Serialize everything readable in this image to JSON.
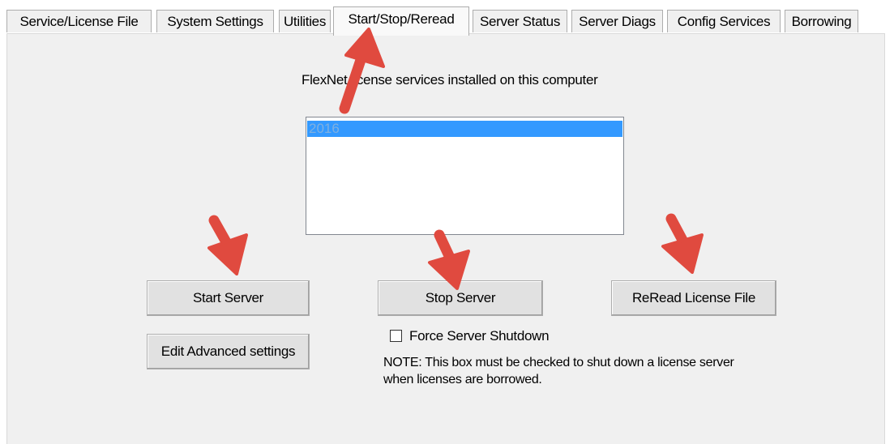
{
  "tabs": [
    {
      "label": "Service/License File"
    },
    {
      "label": "System Settings"
    },
    {
      "label": "Utilities"
    },
    {
      "label": "Start/Stop/Reread"
    },
    {
      "label": "Server Status"
    },
    {
      "label": "Server Diags"
    },
    {
      "label": "Config Services"
    },
    {
      "label": "Borrowing"
    }
  ],
  "active_tab": "Start/Stop/Reread",
  "services": {
    "heading": "FlexNet license services installed on this computer",
    "items": [
      "2016"
    ],
    "selected": "2016"
  },
  "buttons": {
    "start_server": "Start Server",
    "stop_server": "Stop Server",
    "reread_license": "ReRead License File",
    "edit_advanced": "Edit Advanced settings"
  },
  "force_shutdown": {
    "label": "Force Server Shutdown",
    "checked": false
  },
  "note": {
    "line1": "NOTE:  This box must be checked to shut down a license server",
    "line2": "when licenses are borrowed."
  },
  "colors": {
    "annotation_arrow": "#e04a3f",
    "selection": "#3399ff"
  }
}
